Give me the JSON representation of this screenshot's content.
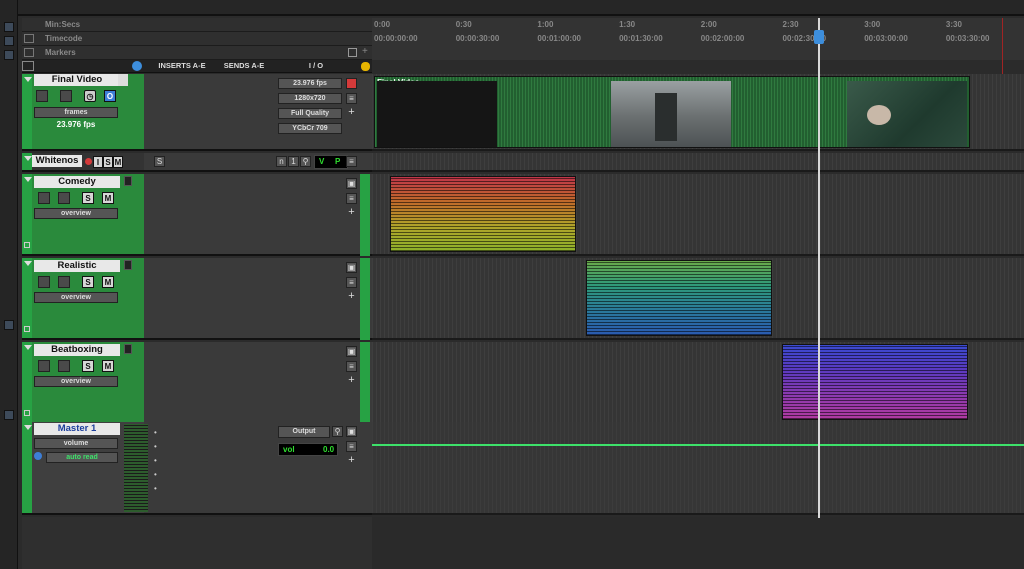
{
  "ruler": {
    "minsecs_label": "Min:Secs",
    "timecode_label": "Timecode",
    "markers_label": "Markers",
    "minsecs_ticks": [
      "0:00",
      "0:30",
      "1:00",
      "1:30",
      "2:00",
      "2:30",
      "3:00",
      "3:30"
    ],
    "timecode_ticks": [
      "00:00:00:00",
      "00:00:30:00",
      "00:01:00:00",
      "00:01:30:00",
      "00:02:00:00",
      "00:02:30:00",
      "00:03:00:00",
      "00:03:30:00"
    ]
  },
  "columns": {
    "inserts": "INSERTS A-E",
    "sends": "SENDS A-E",
    "io": "I / O"
  },
  "video_track": {
    "name": "Final Video",
    "mode": "frames",
    "fps_readout": "23.976 fps",
    "fps_select": "23.976 fps",
    "resolution": "1280x720",
    "quality": "Full Quality",
    "color_space": "YCbCr 709",
    "clip_name": "Final Video",
    "rec_letter": "O"
  },
  "whitenos_track": {
    "name": "Whitenos",
    "i": "I",
    "s": "S",
    "m": "M",
    "n": "n",
    "one": "1",
    "v": "V",
    "p": "P",
    "s2": "S"
  },
  "tracks": [
    {
      "name": "Comedy",
      "s": "S",
      "m": "M",
      "view": "overview"
    },
    {
      "name": "Realistic",
      "s": "S",
      "m": "M",
      "view": "overview"
    },
    {
      "name": "Beatboxing",
      "s": "S",
      "m": "M",
      "view": "overview"
    }
  ],
  "master": {
    "name": "Master 1",
    "view": "volume",
    "automation": "auto read",
    "output": "Output",
    "vol_label": "vol",
    "vol_value": "0.0"
  },
  "colors": {
    "track_green": "#27a244",
    "clip_video": "#1d5c2c",
    "playhead": "#d9d9d9",
    "automation_line": "#3de26a"
  }
}
